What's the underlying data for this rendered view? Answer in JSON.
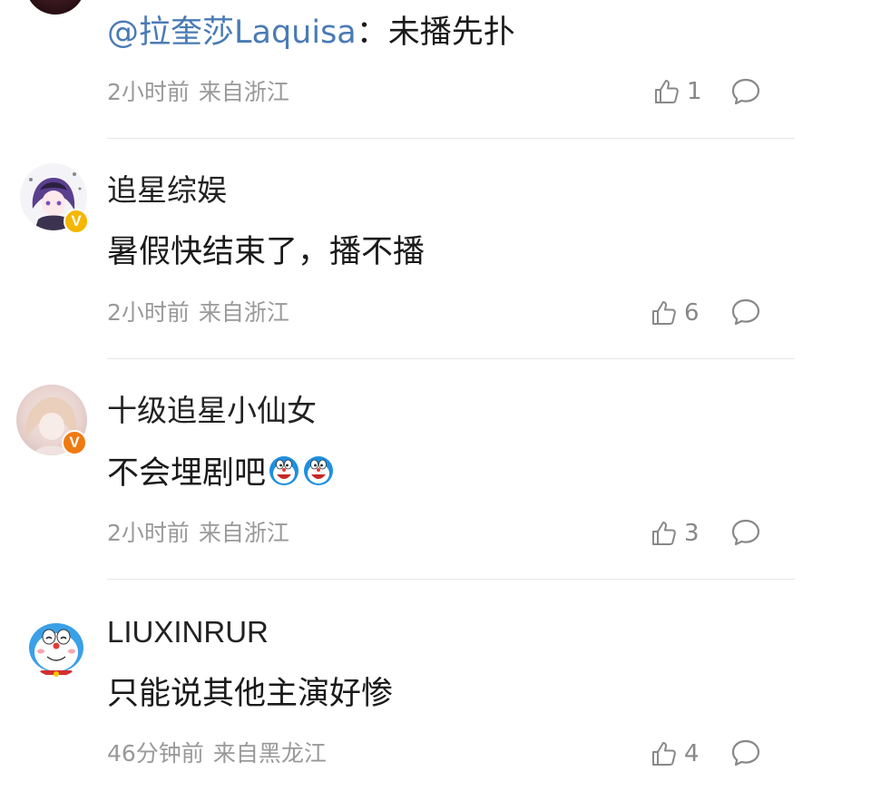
{
  "comments": [
    {
      "user": "",
      "mention": "@拉奎莎Laquisa",
      "text": "：未播先扑",
      "time": "2小时前",
      "location": "来自浙江",
      "likes": "1",
      "avatar_icon": "user-avatar-icon",
      "verified": false
    },
    {
      "user": "追星综娱",
      "text": "暑假快结束了，播不播",
      "time": "2小时前",
      "location": "来自浙江",
      "likes": "6",
      "avatar_icon": "anime-girl-avatar-icon",
      "verified": true,
      "badge": "V",
      "badge_color": "#f5b700"
    },
    {
      "user": "十级追星小仙女",
      "text": "不会埋剧吧",
      "emoji": [
        "doraemon-emoji",
        "doraemon-emoji"
      ],
      "time": "2小时前",
      "location": "来自浙江",
      "likes": "3",
      "avatar_icon": "girl-photo-avatar-icon",
      "verified": true,
      "badge": "V",
      "badge_color": "#f07a12"
    },
    {
      "user": "LIUXINRUR",
      "text": "只能说其他主演好惨",
      "time": "46分钟前",
      "location": "来自黑龙江",
      "likes": "4",
      "avatar_icon": "doraemon-avatar-icon",
      "verified": false
    }
  ],
  "icons": {
    "like": "thumbs-up-icon",
    "reply": "comment-bubble-icon"
  },
  "colors": {
    "mention": "#4a7bb5",
    "meta": "#999999",
    "divider": "#e6e6e6"
  }
}
